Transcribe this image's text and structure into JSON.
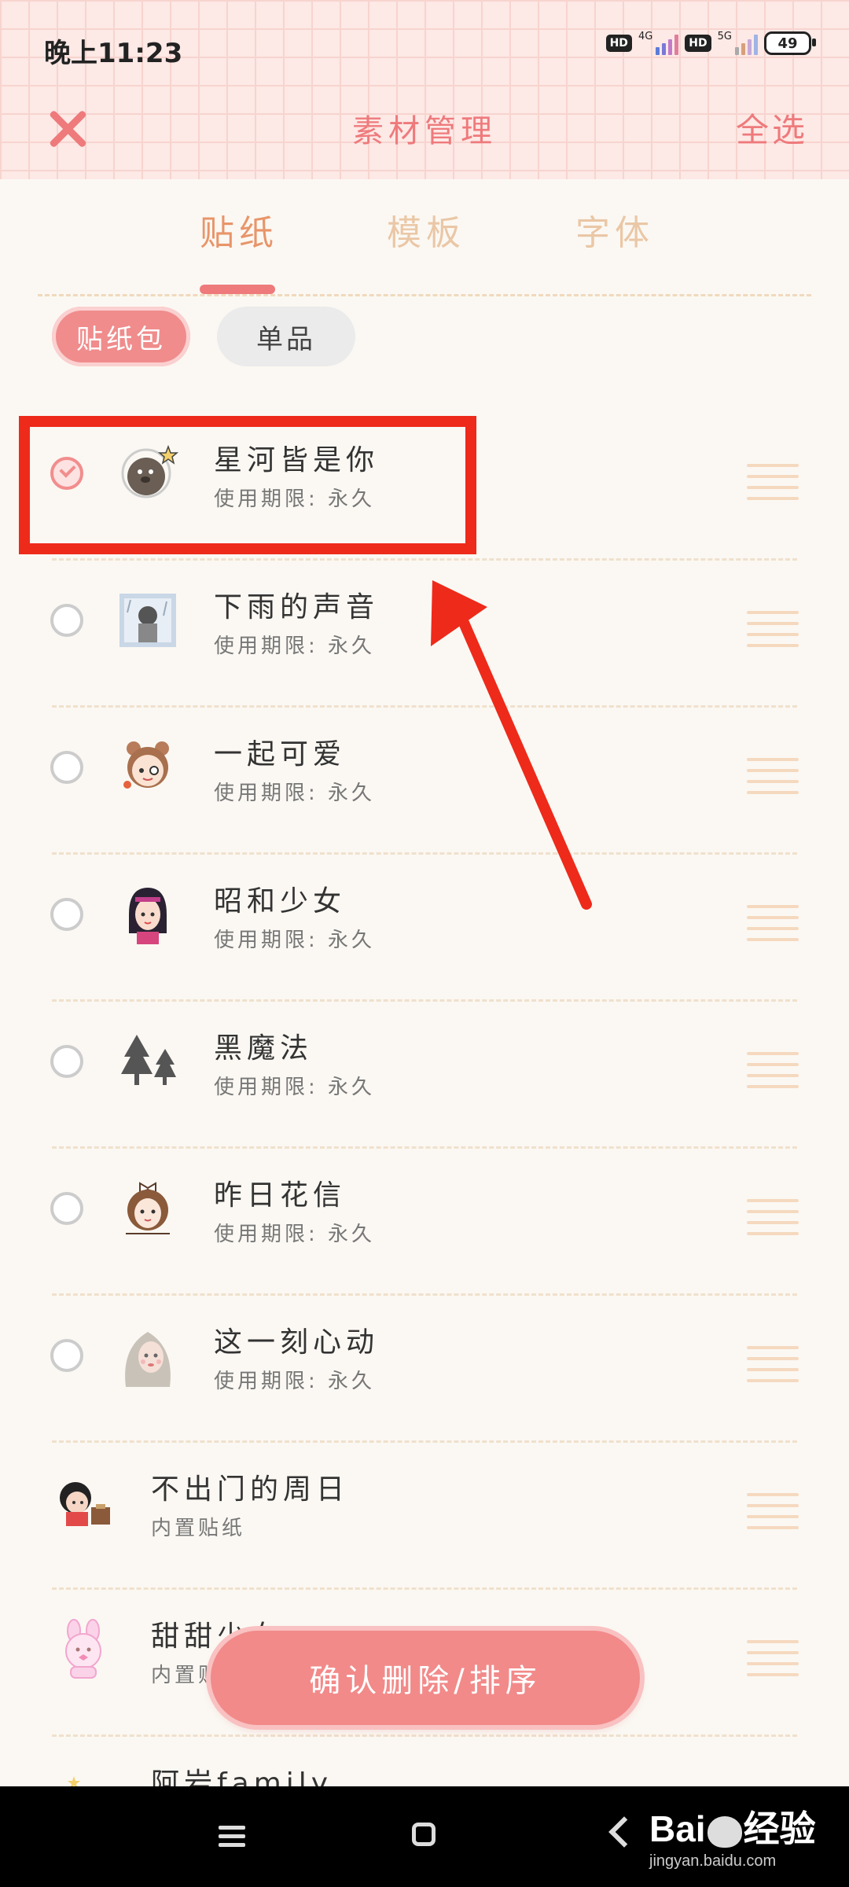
{
  "status_bar": {
    "time": "晚上11:23",
    "hd1": "HD",
    "net1": "4G",
    "hd2": "HD",
    "net2": "5G",
    "battery": "49"
  },
  "header": {
    "title": "素材管理",
    "select_all": "全选"
  },
  "tabs": [
    {
      "label": "贴纸",
      "active": true
    },
    {
      "label": "模板",
      "active": false
    },
    {
      "label": "字体",
      "active": false
    }
  ],
  "chips": [
    {
      "label": "贴纸包",
      "active": true
    },
    {
      "label": "单品",
      "active": false
    }
  ],
  "items": [
    {
      "name": "星河皆是你",
      "sub": "使用期限: 永久",
      "checked": true,
      "icon": "dog-astronaut-icon"
    },
    {
      "name": "下雨的声音",
      "sub": "使用期限: 永久",
      "checked": false,
      "icon": "rainy-window-icon"
    },
    {
      "name": "一起可爱",
      "sub": "使用期限: 永久",
      "checked": false,
      "icon": "girl-bear-ears-icon"
    },
    {
      "name": "昭和少女",
      "sub": "使用期限: 永久",
      "checked": false,
      "icon": "showa-girl-icon"
    },
    {
      "name": "黑魔法",
      "sub": "使用期限: 永久",
      "checked": false,
      "icon": "pine-trees-icon"
    },
    {
      "name": "昨日花信",
      "sub": "使用期限: 永久",
      "checked": false,
      "icon": "bow-girl-icon"
    },
    {
      "name": "这一刻心动",
      "sub": "使用期限: 永久",
      "checked": false,
      "icon": "blonde-girl-icon"
    },
    {
      "name": "不出门的周日",
      "sub": "内置贴纸",
      "builtin": true,
      "icon": "reading-girl-icon"
    },
    {
      "name": "甜甜少女",
      "sub": "内置贴纸",
      "builtin": true,
      "icon": "pink-bunny-icon"
    },
    {
      "name": "阿岩family",
      "sub": "",
      "builtin": true,
      "icon": "family-icon"
    }
  ],
  "confirm_button": "确认删除/排序",
  "watermark": {
    "brand": "Bai",
    "brand2": "经验",
    "url": "jingyan.baidu.com"
  },
  "colors": {
    "accent": "#ee7a7c",
    "annotation": "#ee2a1a",
    "tab_active": "#e8956a"
  }
}
